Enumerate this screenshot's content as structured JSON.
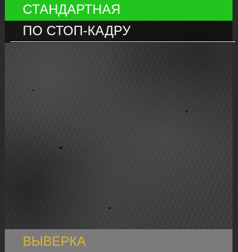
{
  "menu": {
    "items": [
      {
        "label": "СТАНДАРТНАЯ",
        "selected": true
      },
      {
        "label": "ПО СТОП-КАДРУ",
        "selected": false
      }
    ]
  },
  "footer": {
    "label": "ВЫВЕРКА"
  },
  "colors": {
    "selected_bg": "#22c41e",
    "footer_bg": "#7b7b7b",
    "footer_text": "#e0b72c",
    "menu_text": "#ffffff"
  }
}
